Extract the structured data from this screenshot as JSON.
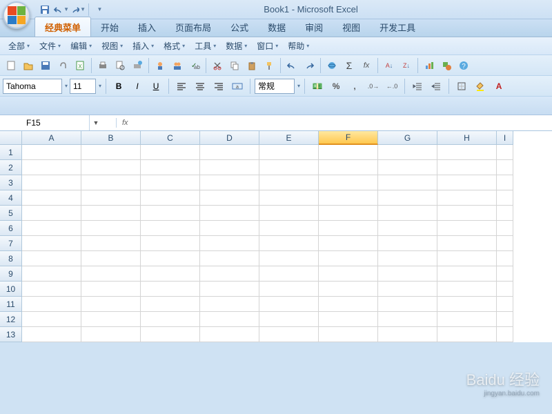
{
  "title": "Book1 - Microsoft Excel",
  "ribbon": {
    "tabs": [
      "经典菜单",
      "开始",
      "插入",
      "页面布局",
      "公式",
      "数据",
      "审阅",
      "视图",
      "开发工具"
    ],
    "active": 0
  },
  "menu": {
    "items": [
      "全部",
      "文件",
      "编辑",
      "视图",
      "插入",
      "格式",
      "工具",
      "数据",
      "窗口",
      "帮助"
    ]
  },
  "font": {
    "name": "Tahoma",
    "size": "11",
    "B": "B",
    "I": "I",
    "U": "U"
  },
  "number_format": "常规",
  "name_box": "F15",
  "fx_label": "fx",
  "columns": [
    "A",
    "B",
    "C",
    "D",
    "E",
    "F",
    "G",
    "H",
    "I"
  ],
  "selected_col": "F",
  "rows": [
    1,
    2,
    3,
    4,
    5,
    6,
    7,
    8,
    9,
    10,
    11,
    12,
    13
  ],
  "watermark": {
    "brand": "Baidu 经验",
    "url": "jingyan.baidu.com"
  }
}
